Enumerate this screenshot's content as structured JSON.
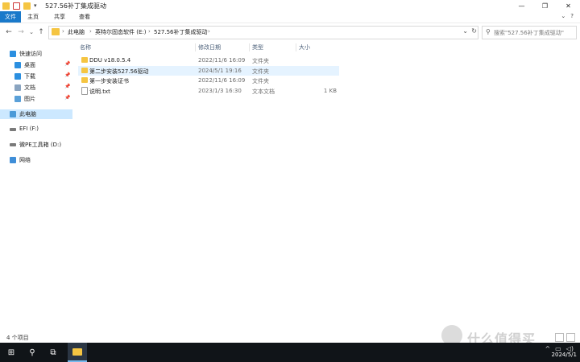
{
  "window": {
    "title": "527.56补丁集成驱动",
    "minimize": "—",
    "maximize": "❐",
    "close": "✕"
  },
  "ribbon": {
    "tabs": [
      "文件",
      "主页",
      "共享",
      "查看"
    ],
    "right_controls": [
      "⌄",
      "?"
    ]
  },
  "address": {
    "crumbs": [
      "此电脑",
      "英特尔固态软件 (E:)",
      "527.56补丁集成驱动"
    ],
    "search_placeholder": "搜索\"527.56补丁集成驱动\""
  },
  "nav": {
    "quick_access": "快速访问",
    "quick_items": [
      {
        "label": "桌面",
        "icon": "desktop-icon",
        "color": "#2b8fe0"
      },
      {
        "label": "下载",
        "icon": "download-icon",
        "color": "#2b8fe0"
      },
      {
        "label": "文档",
        "icon": "documents-icon",
        "color": "#8aa4c0"
      },
      {
        "label": "图片",
        "icon": "pictures-icon",
        "color": "#5aa0d8"
      }
    ],
    "this_pc": "此电脑",
    "drives": [
      {
        "label": "EFI (F:)",
        "icon": "drive-icon"
      },
      {
        "label": "微PE工具箱 (D:)",
        "icon": "drive-icon"
      }
    ],
    "network": "网络"
  },
  "columns": {
    "name": "名称",
    "date": "修改日期",
    "type": "类型",
    "size": "大小"
  },
  "files": [
    {
      "name": "DDU v18.0.5.4",
      "date": "2022/11/6 16:09",
      "type": "文件夹",
      "size": "",
      "kind": "folder"
    },
    {
      "name": "第二步安装527.56驱动",
      "date": "2024/5/1 19:16",
      "type": "文件夹",
      "size": "",
      "kind": "folder"
    },
    {
      "name": "第一步安装证书",
      "date": "2022/11/6 16:09",
      "type": "文件夹",
      "size": "",
      "kind": "folder"
    },
    {
      "name": "说明.txt",
      "date": "2023/1/3 16:30",
      "type": "文本文档",
      "size": "1 KB",
      "kind": "text"
    }
  ],
  "status": {
    "count": "4 个项目"
  },
  "taskbar": {
    "start": "⊞",
    "search": "⚲",
    "taskview": "⧉",
    "time": "2024/5/1"
  },
  "watermark": {
    "text": "什么值得买"
  },
  "colors": {
    "accent": "#1979ca",
    "folder": "#f5c542",
    "taskbar": "#101418",
    "selection": "#cce8ff"
  }
}
